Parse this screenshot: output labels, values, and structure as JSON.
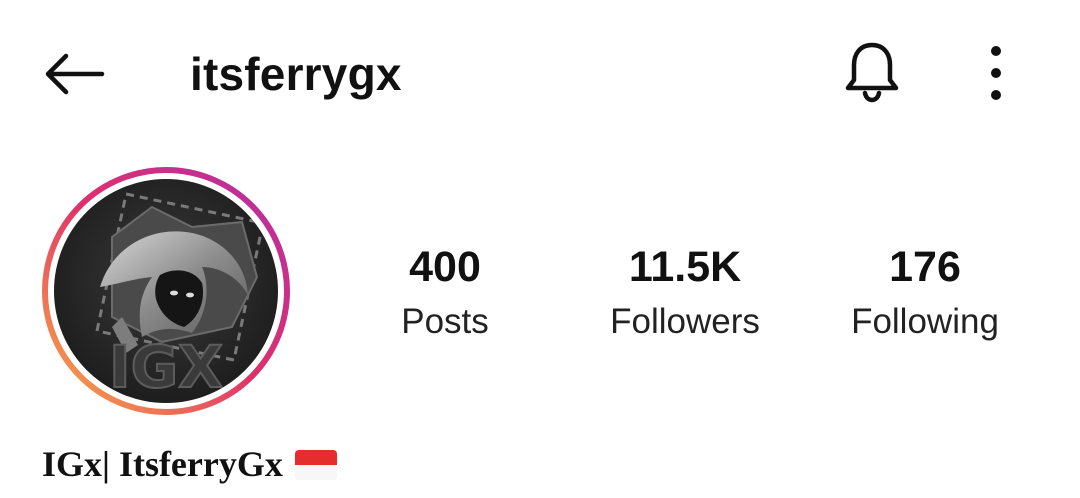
{
  "header": {
    "username": "itsferrygx",
    "back_icon": "arrow-left-icon",
    "bell_icon": "bell-icon",
    "more_icon": "more-vertical-icon"
  },
  "profile": {
    "avatar_icon": "profile-avatar",
    "avatar_text": "IGX",
    "display_name": "IGx| ItsferryGx",
    "flag_icon": "indonesia-flag-icon"
  },
  "stats": [
    {
      "value": "400",
      "label": "Posts"
    },
    {
      "value": "11.5K",
      "label": "Followers"
    },
    {
      "value": "176",
      "label": "Following"
    }
  ],
  "colors": {
    "text": "#111111",
    "background": "#ffffff",
    "story_ring_start": "#f9b243",
    "story_ring_mid": "#e0306a",
    "story_ring_end": "#b12fa8",
    "flag_red": "#e52d2d",
    "flag_white": "#f7f7f7"
  }
}
